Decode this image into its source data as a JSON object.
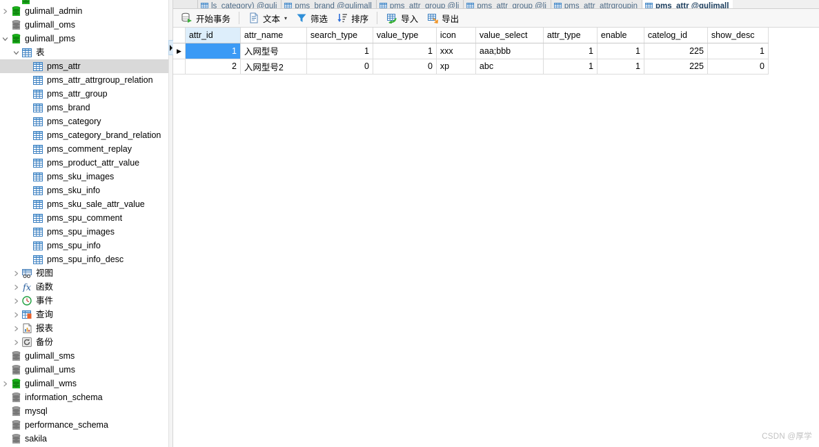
{
  "tabs": [
    {
      "label": "ls_category) @guli",
      "icon": "table-icon",
      "active": false
    },
    {
      "label": "pms_brand @gulimall",
      "icon": "table-icon",
      "active": false
    },
    {
      "label": "pms_attr_group @li",
      "icon": "table-icon",
      "active": false
    },
    {
      "label": "pms_attr_group @li",
      "icon": "table-design-icon",
      "active": false
    },
    {
      "label": "pms_attr_attrgroupin",
      "icon": "table-icon",
      "active": false
    },
    {
      "label": "pms_attr @gulimall",
      "icon": "table-icon",
      "active": true
    }
  ],
  "toolbar": {
    "begin_transaction": "开始事务",
    "begin_transaction_icon": "transaction-icon",
    "text": "文本",
    "text_icon": "document-icon",
    "text_caret": "▾",
    "filter": "筛选",
    "filter_icon": "funnel-icon",
    "sort": "排序",
    "sort_icon": "sort-descending-icon",
    "import": "导入",
    "import_icon": "import-grid-icon",
    "export": "导出",
    "export_icon": "export-grid-icon"
  },
  "sidebar": {
    "items": [
      {
        "label": "gulimall_admin",
        "icon": "database-icon",
        "depth": 1,
        "twisty": "collapsed",
        "state": "connected",
        "selected": false
      },
      {
        "label": "gulimall_oms",
        "icon": "database-icon",
        "depth": 1,
        "twisty": "none",
        "state": "offline",
        "selected": false
      },
      {
        "label": "gulimall_pms",
        "icon": "database-icon",
        "depth": 1,
        "twisty": "expanded",
        "state": "connected",
        "selected": false
      },
      {
        "label": "表",
        "icon": "table-folder-icon",
        "depth": 2,
        "twisty": "expanded",
        "state": "none",
        "selected": false
      },
      {
        "label": "pms_attr",
        "icon": "table-icon",
        "depth": 3,
        "twisty": "none",
        "state": "none",
        "selected": true
      },
      {
        "label": "pms_attr_attrgroup_relation",
        "icon": "table-icon",
        "depth": 3,
        "twisty": "none",
        "state": "none",
        "selected": false
      },
      {
        "label": "pms_attr_group",
        "icon": "table-icon",
        "depth": 3,
        "twisty": "none",
        "state": "none",
        "selected": false
      },
      {
        "label": "pms_brand",
        "icon": "table-icon",
        "depth": 3,
        "twisty": "none",
        "state": "none",
        "selected": false
      },
      {
        "label": "pms_category",
        "icon": "table-icon",
        "depth": 3,
        "twisty": "none",
        "state": "none",
        "selected": false
      },
      {
        "label": "pms_category_brand_relation",
        "icon": "table-icon",
        "depth": 3,
        "twisty": "none",
        "state": "none",
        "selected": false
      },
      {
        "label": "pms_comment_replay",
        "icon": "table-icon",
        "depth": 3,
        "twisty": "none",
        "state": "none",
        "selected": false
      },
      {
        "label": "pms_product_attr_value",
        "icon": "table-icon",
        "depth": 3,
        "twisty": "none",
        "state": "none",
        "selected": false
      },
      {
        "label": "pms_sku_images",
        "icon": "table-icon",
        "depth": 3,
        "twisty": "none",
        "state": "none",
        "selected": false
      },
      {
        "label": "pms_sku_info",
        "icon": "table-icon",
        "depth": 3,
        "twisty": "none",
        "state": "none",
        "selected": false
      },
      {
        "label": "pms_sku_sale_attr_value",
        "icon": "table-icon",
        "depth": 3,
        "twisty": "none",
        "state": "none",
        "selected": false
      },
      {
        "label": "pms_spu_comment",
        "icon": "table-icon",
        "depth": 3,
        "twisty": "none",
        "state": "none",
        "selected": false
      },
      {
        "label": "pms_spu_images",
        "icon": "table-icon",
        "depth": 3,
        "twisty": "none",
        "state": "none",
        "selected": false
      },
      {
        "label": "pms_spu_info",
        "icon": "table-icon",
        "depth": 3,
        "twisty": "none",
        "state": "none",
        "selected": false
      },
      {
        "label": "pms_spu_info_desc",
        "icon": "table-icon",
        "depth": 3,
        "twisty": "none",
        "state": "none",
        "selected": false
      },
      {
        "label": "视图",
        "icon": "view-icon",
        "depth": 2,
        "twisty": "collapsed",
        "state": "none",
        "selected": false
      },
      {
        "label": "函数",
        "icon": "function-icon",
        "depth": 2,
        "twisty": "collapsed",
        "state": "none",
        "selected": false
      },
      {
        "label": "事件",
        "icon": "event-clock-icon",
        "depth": 2,
        "twisty": "collapsed",
        "state": "none",
        "selected": false
      },
      {
        "label": "查询",
        "icon": "query-icon",
        "depth": 2,
        "twisty": "collapsed",
        "state": "none",
        "selected": false
      },
      {
        "label": "报表",
        "icon": "report-icon",
        "depth": 2,
        "twisty": "collapsed",
        "state": "none",
        "selected": false
      },
      {
        "label": "备份",
        "icon": "backup-icon",
        "depth": 2,
        "twisty": "collapsed",
        "state": "none",
        "selected": false
      },
      {
        "label": "gulimall_sms",
        "icon": "database-icon",
        "depth": 1,
        "twisty": "none",
        "state": "offline",
        "selected": false
      },
      {
        "label": "gulimall_ums",
        "icon": "database-icon",
        "depth": 1,
        "twisty": "none",
        "state": "offline",
        "selected": false
      },
      {
        "label": "gulimall_wms",
        "icon": "database-icon",
        "depth": 1,
        "twisty": "collapsed",
        "state": "connected",
        "selected": false
      },
      {
        "label": "information_schema",
        "icon": "database-icon",
        "depth": 1,
        "twisty": "none",
        "state": "offline",
        "selected": false
      },
      {
        "label": "mysql",
        "icon": "database-icon",
        "depth": 1,
        "twisty": "none",
        "state": "offline",
        "selected": false
      },
      {
        "label": "performance_schema",
        "icon": "database-icon",
        "depth": 1,
        "twisty": "none",
        "state": "offline",
        "selected": false
      },
      {
        "label": "sakila",
        "icon": "database-icon",
        "depth": 1,
        "twisty": "none",
        "state": "offline",
        "selected": false
      }
    ]
  },
  "grid": {
    "columns": [
      {
        "name": "attr_id",
        "width": 80,
        "align": "num",
        "active": true
      },
      {
        "name": "attr_name",
        "width": 96,
        "align": "txt",
        "active": false
      },
      {
        "name": "search_type",
        "width": 96,
        "align": "num",
        "active": false
      },
      {
        "name": "value_type",
        "width": 92,
        "align": "num",
        "active": false
      },
      {
        "name": "icon",
        "width": 57,
        "align": "txt",
        "active": false
      },
      {
        "name": "value_select",
        "width": 98,
        "align": "txt",
        "active": false
      },
      {
        "name": "attr_type",
        "width": 78,
        "align": "num",
        "active": false
      },
      {
        "name": "enable",
        "width": 68,
        "align": "num",
        "active": false
      },
      {
        "name": "catelog_id",
        "width": 92,
        "align": "num",
        "active": false
      },
      {
        "name": "show_desc",
        "width": 88,
        "align": "num",
        "active": false
      }
    ],
    "rows": [
      {
        "current": true,
        "marker": "▶",
        "cells": [
          "1",
          "入网型号",
          "1",
          "1",
          "xxx",
          "aaa;bbb",
          "1",
          "1",
          "225",
          "1"
        ]
      },
      {
        "current": false,
        "marker": "",
        "cells": [
          "2",
          "入网型号2",
          "0",
          "0",
          "xp",
          "abc",
          "1",
          "1",
          "225",
          "0"
        ]
      }
    ]
  },
  "watermark": "CSDN @厚学"
}
